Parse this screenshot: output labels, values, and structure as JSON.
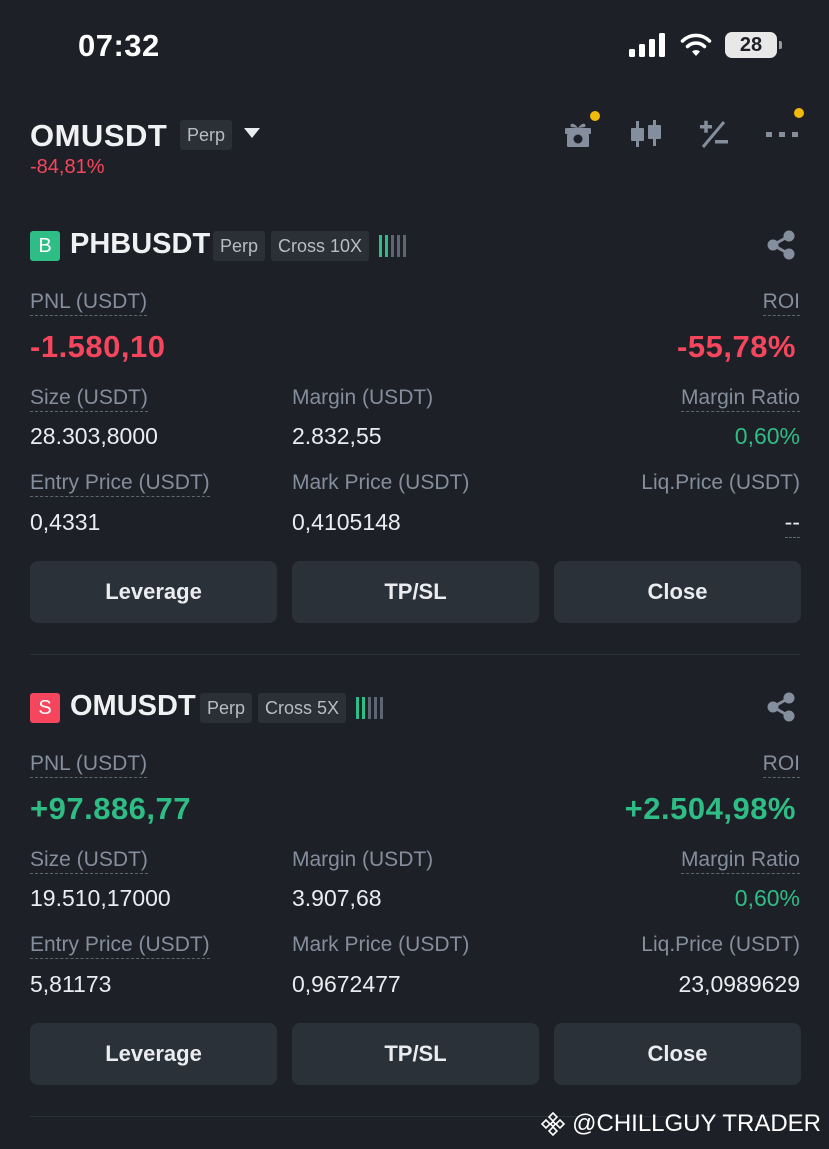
{
  "status_bar": {
    "time": "07:32",
    "battery": "28"
  },
  "header": {
    "symbol": "OMUSDT",
    "contract_type": "Perp",
    "change": "-84,81%"
  },
  "positions": [
    {
      "side": "B",
      "symbol": "PHBUSDT",
      "contract_type": "Perp",
      "margin_mode": "Cross 10X",
      "pnl_label": "PNL (USDT)",
      "pnl_value": "-1.580,10",
      "roi_label": "ROI",
      "roi_value": "-55,78%",
      "size_label": "Size (USDT)",
      "size_value": "28.303,8000",
      "margin_label": "Margin (USDT)",
      "margin_value": "2.832,55",
      "margin_ratio_label": "Margin Ratio",
      "margin_ratio_value": "0,60%",
      "entry_label": "Entry Price (USDT)",
      "entry_value": "0,4331",
      "mark_label": "Mark Price (USDT)",
      "mark_value": "0,4105148",
      "liq_label": "Liq.Price (USDT)",
      "liq_value": "--",
      "buttons": {
        "leverage": "Leverage",
        "tpsl": "TP/SL",
        "close": "Close"
      }
    },
    {
      "side": "S",
      "symbol": "OMUSDT",
      "contract_type": "Perp",
      "margin_mode": "Cross 5X",
      "pnl_label": "PNL (USDT)",
      "pnl_value": "+97.886,77",
      "roi_label": "ROI",
      "roi_value": "+2.504,98%",
      "size_label": "Size (USDT)",
      "size_value": "19.510,17000",
      "margin_label": "Margin (USDT)",
      "margin_value": "3.907,68",
      "margin_ratio_label": "Margin Ratio",
      "margin_ratio_value": "0,60%",
      "entry_label": "Entry Price (USDT)",
      "entry_value": "5,81173",
      "mark_label": "Mark Price (USDT)",
      "mark_value": "0,9672477",
      "liq_label": "Liq.Price (USDT)",
      "liq_value": "23,0989629",
      "buttons": {
        "leverage": "Leverage",
        "tpsl": "TP/SL",
        "close": "Close"
      }
    }
  ],
  "watermark": "@CHILLGUY TRADER",
  "colors": {
    "background": "#1e2027",
    "positive": "#2ebd85",
    "negative": "#f6465d",
    "button": "#2b3139",
    "notification_dot": "#f0b90b"
  },
  "icons": [
    "signal-icon",
    "wifi-icon",
    "battery-icon",
    "caret-down-icon",
    "gift-icon",
    "candlestick-icon",
    "plus-minus-icon",
    "more-icon",
    "share-icon",
    "binance-logo-icon"
  ]
}
